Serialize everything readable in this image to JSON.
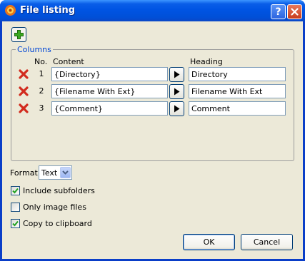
{
  "window": {
    "title": "File listing"
  },
  "title_buttons": {
    "help": "?"
  },
  "columns_group": {
    "label": "Columns",
    "headers": {
      "no": "No.",
      "content": "Content",
      "heading": "Heading"
    },
    "rows": [
      {
        "no": "1",
        "content": "{Directory}",
        "heading": "Directory"
      },
      {
        "no": "2",
        "content": "{Filename With Ext}",
        "heading": "Filename With Ext"
      },
      {
        "no": "3",
        "content": "{Comment}",
        "heading": "Comment"
      }
    ]
  },
  "format": {
    "label": "Format",
    "value": "Text"
  },
  "options": {
    "include_subfolders": {
      "label": "Include subfolders",
      "checked": true
    },
    "only_image_files": {
      "label": "Only image files",
      "checked": false
    },
    "copy_to_clipboard": {
      "label": "Copy to clipboard",
      "checked": true
    }
  },
  "buttons": {
    "ok": "OK",
    "cancel": "Cancel"
  },
  "colors": {
    "titlebar": "#0054e3",
    "face": "#ece9d8",
    "group_label": "#0046d5",
    "delete": "#d22b1e",
    "add": "#2f9a1c"
  }
}
